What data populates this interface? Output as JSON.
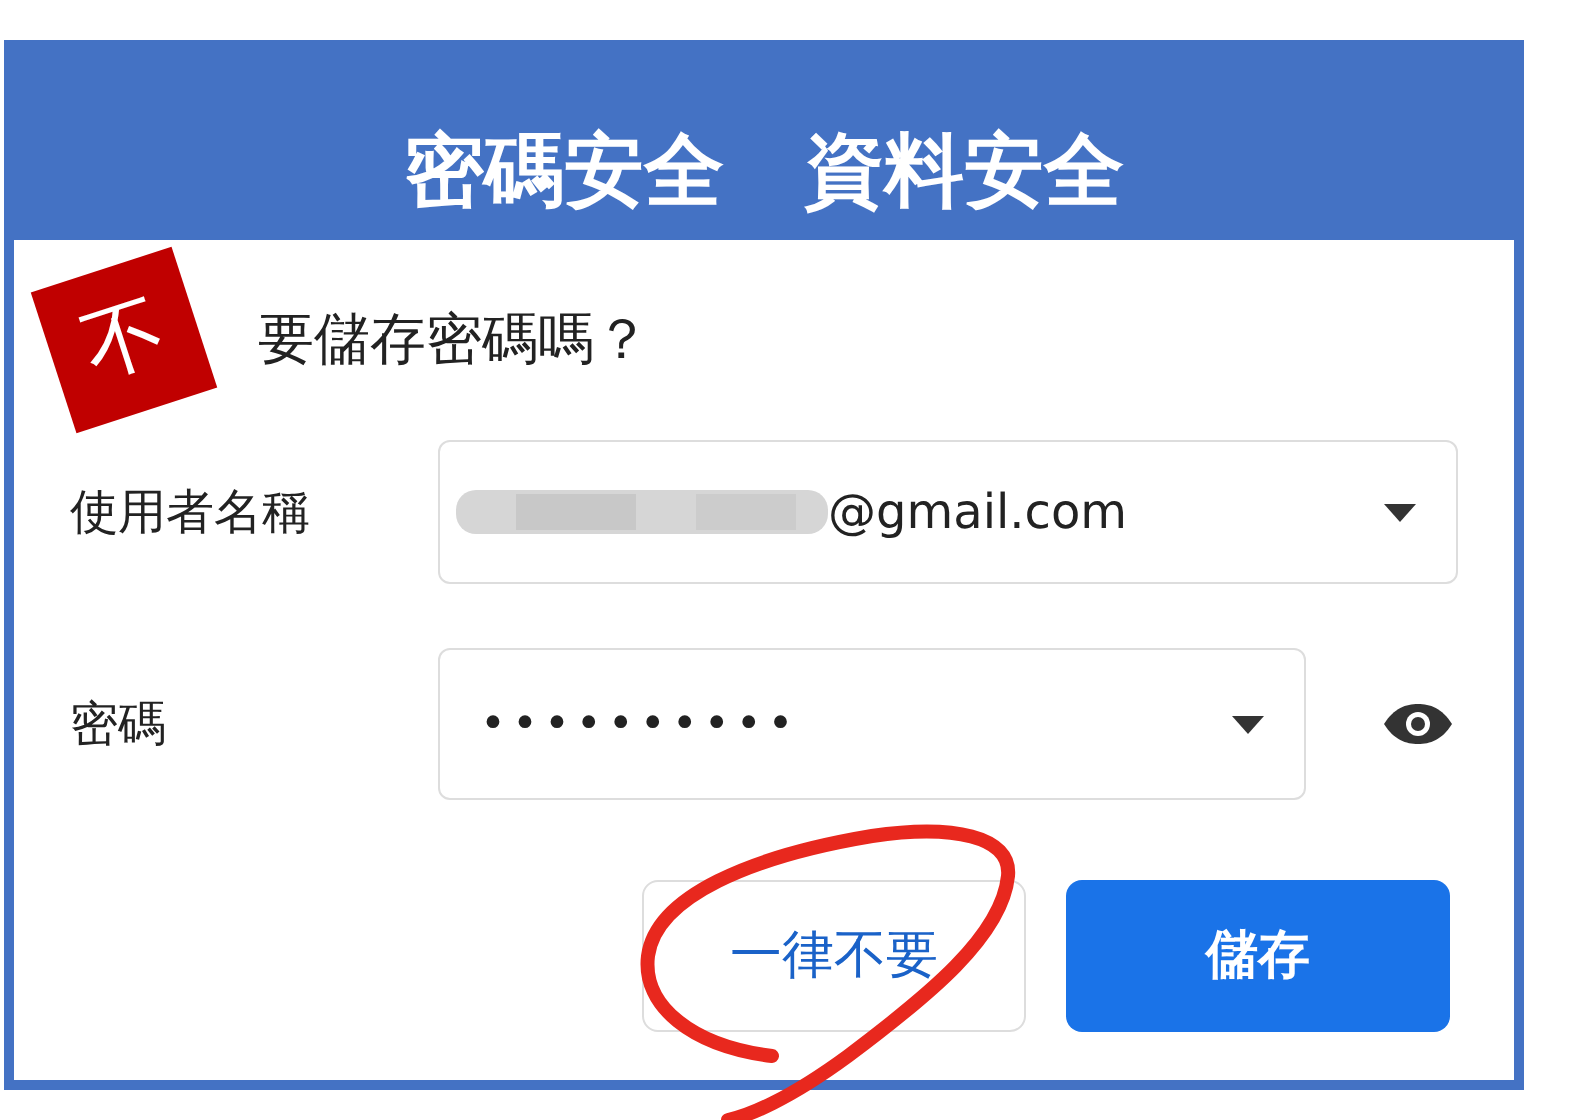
{
  "banner": {
    "title": "密碼安全　資料安全"
  },
  "stamp": {
    "text": "不"
  },
  "dialog": {
    "title": "要儲存密碼嗎？",
    "fields": [
      {
        "kind": "username",
        "label": "使用者名稱",
        "value": "@gmail.com"
      },
      {
        "kind": "password",
        "label": "密碼",
        "value": "••••••••••"
      }
    ],
    "buttons": [
      {
        "kind": "secondary",
        "label": "一律不要"
      },
      {
        "kind": "primary",
        "label": "儲存"
      }
    ]
  }
}
